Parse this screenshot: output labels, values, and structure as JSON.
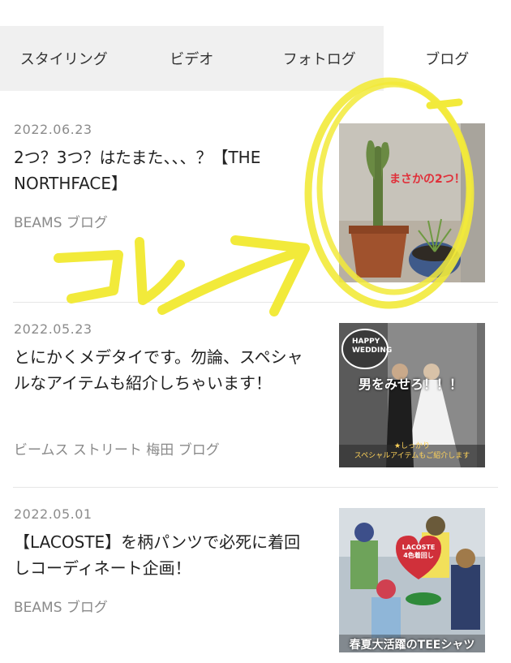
{
  "tabs": [
    {
      "label": "スタイリング",
      "active": false
    },
    {
      "label": "ビデオ",
      "active": false
    },
    {
      "label": "フォトログ",
      "active": false
    },
    {
      "label": "ブログ",
      "active": true
    }
  ],
  "articles": [
    {
      "date": "2022.06.23",
      "title": "2つ？3つ？はたまた、、、？【THE NORTHFACE】",
      "source": "BEAMS ブログ",
      "thumb_caption": "まさかの2つ！？"
    },
    {
      "date": "2022.05.23",
      "title": "とにかくメデタイです。勿論、スペシャルなアイテムも紹介しちゃいます！",
      "source": "ビームス ストリート 梅田 ブログ",
      "thumb_caption": "男をみせろ！！！",
      "thumb_badge_line1": "HAPPY",
      "thumb_badge_line2": "WEDDING",
      "thumb_footer_line1": "★しっかり",
      "thumb_footer_line2": "スペシャルアイテムもご紹介します"
    },
    {
      "date": "2022.05.01",
      "title": "【LACOSTE】を柄パンツで必死に着回しコーディネート企画！",
      "source": "BEAMS ブログ",
      "thumb_caption": "春夏大活躍のTEEシャツ",
      "thumb_badge_line1": "LACOSTE",
      "thumb_badge_line2": "4色着回し"
    }
  ],
  "annotation": {
    "text": "コレ",
    "color": "#f2ea3a"
  },
  "colors": {
    "tab_bg": "#f0f0f0",
    "text_muted": "#8c8c8c",
    "highlight": "#f2ea3a",
    "caption_red": "#e0303a"
  }
}
